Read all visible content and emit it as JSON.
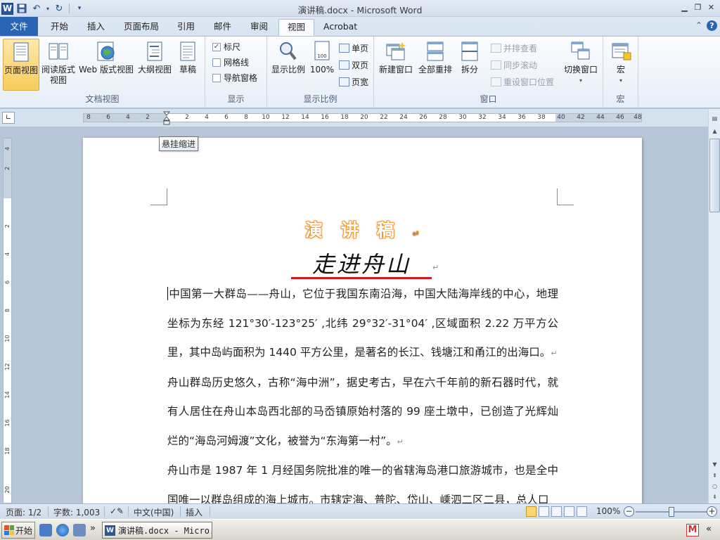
{
  "window": {
    "title": "演讲稿.docx - Microsoft Word",
    "app_logo": "W"
  },
  "tabs": {
    "file": "文件",
    "items": [
      "开始",
      "插入",
      "页面布局",
      "引用",
      "邮件",
      "审阅",
      "视图",
      "Acrobat"
    ],
    "active": "视图"
  },
  "ribbon": {
    "doc_views": {
      "label": "文档视图",
      "print_layout": "页面视图",
      "full_screen_line1": "阅读版式",
      "full_screen_line2": "视图",
      "web_layout": "Web 版式视图",
      "outline": "大纲视图",
      "draft": "草稿"
    },
    "show": {
      "label": "显示",
      "ruler": "标尺",
      "ruler_checked": true,
      "gridlines": "网格线",
      "gridlines_checked": false,
      "nav_pane": "导航窗格",
      "nav_pane_checked": false
    },
    "zoom": {
      "label": "显示比例",
      "zoom": "显示比例",
      "hundred": "100%",
      "one_page": "单页",
      "two_pages": "双页",
      "page_width": "页宽"
    },
    "window": {
      "label": "窗口",
      "new_window": "新建窗口",
      "arrange_all": "全部重排",
      "split": "拆分",
      "side_by_side": "并排查看",
      "sync_scroll": "同步滚动",
      "reset_position": "重设窗口位置",
      "switch_windows": "切换窗口"
    },
    "macros": {
      "label": "宏",
      "macros": "宏"
    }
  },
  "ruler": {
    "numbers": [
      "8",
      "6",
      "4",
      "2",
      "",
      "2",
      "4",
      "6",
      "8",
      "10",
      "12",
      "14",
      "16",
      "18",
      "20",
      "22",
      "24",
      "26",
      "28",
      "30",
      "32",
      "34",
      "36",
      "38",
      "40",
      "42",
      "44",
      "46",
      "48"
    ],
    "vertical_numbers": [
      "4",
      "2",
      "2",
      "4",
      "6",
      "8",
      "10",
      "12",
      "14",
      "16",
      "18",
      "20"
    ]
  },
  "tooltip": "悬挂缩进",
  "document": {
    "heading": "演讲稿",
    "title": "走进舟山",
    "paragraph_mark": "↵",
    "paragraphs": [
      "中国第一大群岛——舟山，它位于我国东南沿海，中国大陆海岸线的中心，地理坐标为东经 121°30′-123°25′ ,北纬 29°32′-31°04′ ,区域面积 2.22 万平方公里，其中岛屿面积为 1440 平方公里，是著名的长江、钱塘江和甬江的出海口。",
      "舟山群岛历史悠久，古称“海中洲”，据史考古，早在六千年前的新石器时代，就有人居住在舟山本岛西北部的马岙镇原始村落的 99 座土墩中，已创造了光辉灿烂的“海岛河姆渡”文化，被誉为“东海第一村”。",
      "舟山市是 1987 年 1 月经国务院批准的唯一的省辖海岛港口旅游城市，也是全中国唯一以群岛组成的海上城市。市辖定海、普陀、岱山、嵊泗二区二县，总人口"
    ]
  },
  "statusbar": {
    "page": "页面: 1/2",
    "words": "字数: 1,003",
    "language": "中文(中国)",
    "mode": "插入",
    "zoom": "100%",
    "zoom_minus": "−",
    "zoom_plus": "+",
    "zoom_level": 0.5
  },
  "taskbar": {
    "start": "开始",
    "task": "演讲稿.docx - Micro...",
    "more": "»",
    "tray_logo": "M",
    "tray_more": "«"
  },
  "colors": {
    "file_tab": "#2a65b5",
    "heading_glow": "#e98f2a",
    "title_underline": "#d01c1c",
    "selected_view": "#f8cb5c"
  }
}
